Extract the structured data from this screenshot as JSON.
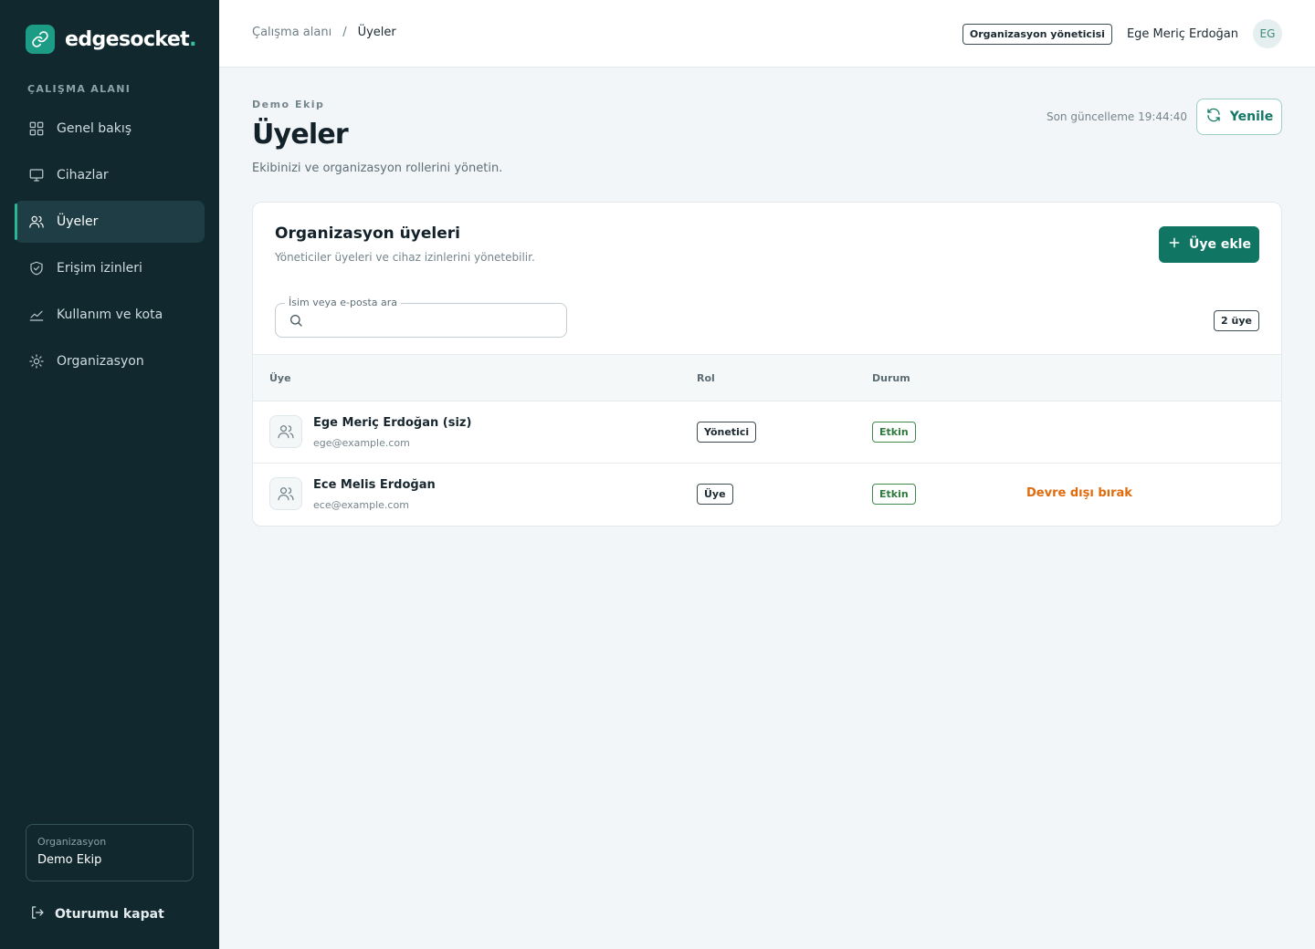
{
  "brand": {
    "name": "edgesocket",
    "dot": ".",
    "accent": "#1c9c84"
  },
  "sidebar": {
    "section_label": "ÇALIŞMA ALANI",
    "items": [
      {
        "label": "Genel bakış",
        "icon": "grid-icon",
        "active": false
      },
      {
        "label": "Cihazlar",
        "icon": "monitor-icon",
        "active": false
      },
      {
        "label": "Üyeler",
        "icon": "users-icon",
        "active": true
      },
      {
        "label": "Erişim izinleri",
        "icon": "shield-check-icon",
        "active": false
      },
      {
        "label": "Kullanım ve kota",
        "icon": "chart-line-icon",
        "active": false
      },
      {
        "label": "Organizasyon",
        "icon": "sun-gear-icon",
        "active": false
      }
    ],
    "org_label": "Organizasyon",
    "org_name": "Demo Ekip",
    "logout_label": "Oturumu kapat"
  },
  "topbar": {
    "breadcrumb_root": "Çalışma alanı",
    "breadcrumb_sep": "/",
    "breadcrumb_current": "Üyeler",
    "role_badge": "Organizasyon yöneticisi",
    "user_name": "Ege Meriç Erdoğan",
    "avatar_initials": "EG"
  },
  "header": {
    "eyebrow": "Demo Ekip",
    "title": "Üyeler",
    "subtitle": "Ekibinizi ve organizasyon rollerini yönetin.",
    "updated": "Son güncelleme 19:44:40",
    "refresh_label": "Yenile"
  },
  "card": {
    "title": "Organizasyon üyeleri",
    "subtitle": "Yöneticiler üyeleri ve cihaz izinlerini yönetebilir.",
    "add_label": "Üye ekle",
    "search_label": "İsim veya e-posta ara",
    "search_value": "",
    "count_label": "2 üye",
    "columns": {
      "member": "Üye",
      "role": "Rol",
      "status": "Durum"
    },
    "rows": [
      {
        "name": "Ege Meriç Erdoğan (siz)",
        "email": "ege@example.com",
        "role": "Yönetici",
        "status": "Etkin",
        "action": ""
      },
      {
        "name": "Ece Melis Erdoğan",
        "email": "ece@example.com",
        "role": "Üye",
        "status": "Etkin",
        "action": "Devre dışı bırak"
      }
    ]
  },
  "colors": {
    "sidebar_bg": "#11282f",
    "primary": "#117564",
    "status_ok": "#2f7a3d",
    "danger_action": "#e06b0c"
  }
}
